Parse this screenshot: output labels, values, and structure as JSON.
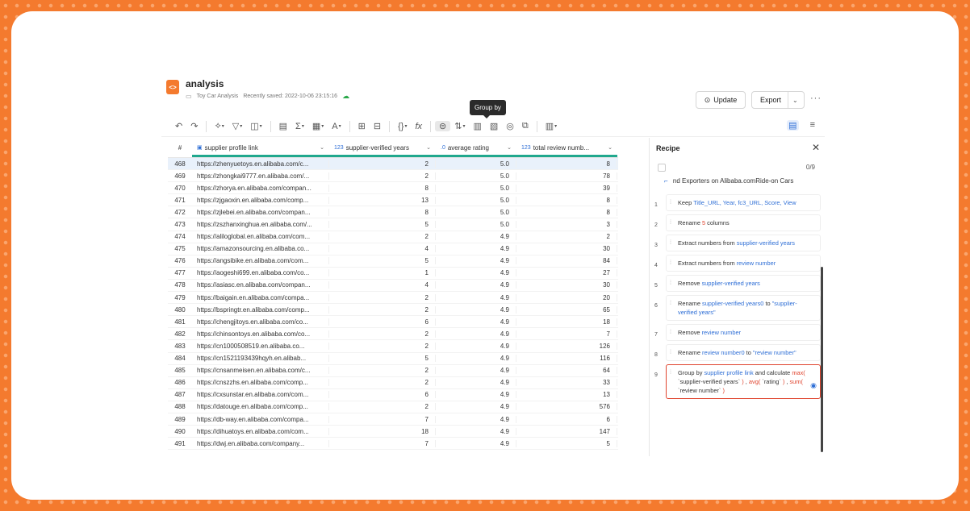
{
  "header": {
    "title": "analysis",
    "project": "Toy Car Analysis",
    "saved": "Recently saved: 2022-10-06 23:15:16",
    "tooltip": "Group by",
    "update_label": "Update",
    "export_label": "Export"
  },
  "toolbar": {
    "icons": [
      "undo-icon",
      "redo-icon",
      "transform-icon",
      "filter-icon",
      "columns-icon",
      "table-icon",
      "sum-icon",
      "date-icon",
      "text-format-icon",
      "split-icon",
      "merge-icon",
      "braces-icon",
      "fx-icon",
      "group-by-icon",
      "sort-icon",
      "pivot-icon",
      "unpivot-icon",
      "join-icon",
      "append-icon",
      "chart-icon"
    ]
  },
  "grid": {
    "headers": {
      "num": "#",
      "link": "supplier profile link",
      "yrs": "supplier-verified years",
      "rating": "average rating",
      "review": "total review numb..."
    },
    "rows": [
      [
        "468",
        "https://zhenyuetoys.en.alibaba.com/c...",
        "2",
        "5.0",
        "8"
      ],
      [
        "469",
        "https://zhongkai9777.en.alibaba.com/...",
        "2",
        "5.0",
        "78"
      ],
      [
        "470",
        "https://zhorya.en.alibaba.com/compan...",
        "8",
        "5.0",
        "39"
      ],
      [
        "471",
        "https://zjgaoxin.en.alibaba.com/comp...",
        "13",
        "5.0",
        "8"
      ],
      [
        "472",
        "https://zjlebei.en.alibaba.com/compan...",
        "8",
        "5.0",
        "8"
      ],
      [
        "473",
        "https://zszhanxinghua.en.alibaba.com/...",
        "5",
        "5.0",
        "3"
      ],
      [
        "474",
        "https://aliloglobal.en.alibaba.com/com...",
        "2",
        "4.9",
        "2"
      ],
      [
        "475",
        "https://amazonsourcing.en.alibaba.co...",
        "4",
        "4.9",
        "30"
      ],
      [
        "476",
        "https://angsibike.en.alibaba.com/com...",
        "5",
        "4.9",
        "84"
      ],
      [
        "477",
        "https://aogeshi699.en.alibaba.com/co...",
        "1",
        "4.9",
        "27"
      ],
      [
        "478",
        "https://asiasc.en.alibaba.com/compan...",
        "4",
        "4.9",
        "30"
      ],
      [
        "479",
        "https://baigain.en.alibaba.com/compa...",
        "2",
        "4.9",
        "20"
      ],
      [
        "480",
        "https://bspringtr.en.alibaba.com/comp...",
        "2",
        "4.9",
        "65"
      ],
      [
        "481",
        "https://chengjitoys.en.alibaba.com/co...",
        "6",
        "4.9",
        "18"
      ],
      [
        "482",
        "https://chinsontoys.en.alibaba.com/co...",
        "2",
        "4.9",
        "7"
      ],
      [
        "483",
        "https://cn1000508519.en.alibaba.co...",
        "2",
        "4.9",
        "126"
      ],
      [
        "484",
        "https://cn1521193439hqyh.en.alibab...",
        "5",
        "4.9",
        "116"
      ],
      [
        "485",
        "https://cnsanmeisen.en.alibaba.com/c...",
        "2",
        "4.9",
        "64"
      ],
      [
        "486",
        "https://cnszzhs.en.alibaba.com/comp...",
        "2",
        "4.9",
        "33"
      ],
      [
        "487",
        "https://cxsunstar.en.alibaba.com/com...",
        "6",
        "4.9",
        "13"
      ],
      [
        "488",
        "https://datouge.en.alibaba.com/comp...",
        "2",
        "4.9",
        "576"
      ],
      [
        "489",
        "https://db-way.en.alibaba.com/compa...",
        "7",
        "4.9",
        "6"
      ],
      [
        "490",
        "https://dihuatoys.en.alibaba.com/com...",
        "18",
        "4.9",
        "147"
      ],
      [
        "491",
        "https://dwj.en.alibaba.com/company...",
        "7",
        "4.9",
        "5"
      ]
    ]
  },
  "recipe": {
    "title": "Recipe",
    "count": "0/9",
    "source": "nd Exporters on Alibaba.comRide-on Cars",
    "steps": [
      {
        "n": "1",
        "parts": [
          [
            "Keep ",
            ""
          ],
          [
            "Title_URL, Year, fc3_URL, Score, View",
            "b"
          ]
        ]
      },
      {
        "n": "2",
        "parts": [
          [
            "Rename ",
            ""
          ],
          [
            "5",
            "r"
          ],
          [
            " columns",
            ""
          ]
        ]
      },
      {
        "n": "3",
        "parts": [
          [
            "Extract numbers from ",
            ""
          ],
          [
            "supplier-verified years",
            "b"
          ]
        ]
      },
      {
        "n": "4",
        "parts": [
          [
            "Extract numbers from ",
            ""
          ],
          [
            "review number",
            "b"
          ]
        ]
      },
      {
        "n": "5",
        "parts": [
          [
            "Remove ",
            ""
          ],
          [
            "supplier-verified years",
            "b"
          ]
        ]
      },
      {
        "n": "6",
        "parts": [
          [
            "Rename ",
            ""
          ],
          [
            "supplier-verified years0",
            "b"
          ],
          [
            " to ",
            ""
          ],
          [
            "\"supplier-verified years\"",
            "b"
          ]
        ]
      },
      {
        "n": "7",
        "parts": [
          [
            "Remove ",
            ""
          ],
          [
            "review number",
            "b"
          ]
        ]
      },
      {
        "n": "8",
        "parts": [
          [
            "Rename ",
            ""
          ],
          [
            "review number0",
            "b"
          ],
          [
            " to ",
            ""
          ],
          [
            "\"review number\"",
            "b"
          ]
        ]
      },
      {
        "n": "9",
        "parts": [
          [
            "Group by ",
            ""
          ],
          [
            "supplier profile link",
            "b"
          ],
          [
            " and calculate ",
            ""
          ],
          [
            "max(",
            "r"
          ],
          [
            " `supplier-verified years` ",
            ""
          ],
          [
            ")",
            "r"
          ],
          [
            " , ",
            ""
          ],
          [
            "avg(",
            "r"
          ],
          [
            " `rating` ",
            ""
          ],
          [
            ")",
            "r"
          ],
          [
            " , ",
            ""
          ],
          [
            "sum(",
            "r"
          ],
          [
            " `review number` ",
            ""
          ],
          [
            ")",
            "r"
          ]
        ]
      }
    ]
  },
  "colors": {
    "accent": "#f47a2e",
    "link_blue": "#2f6fd6",
    "highlight_red": "#e0442e",
    "quality_bar": "#20a88e"
  }
}
